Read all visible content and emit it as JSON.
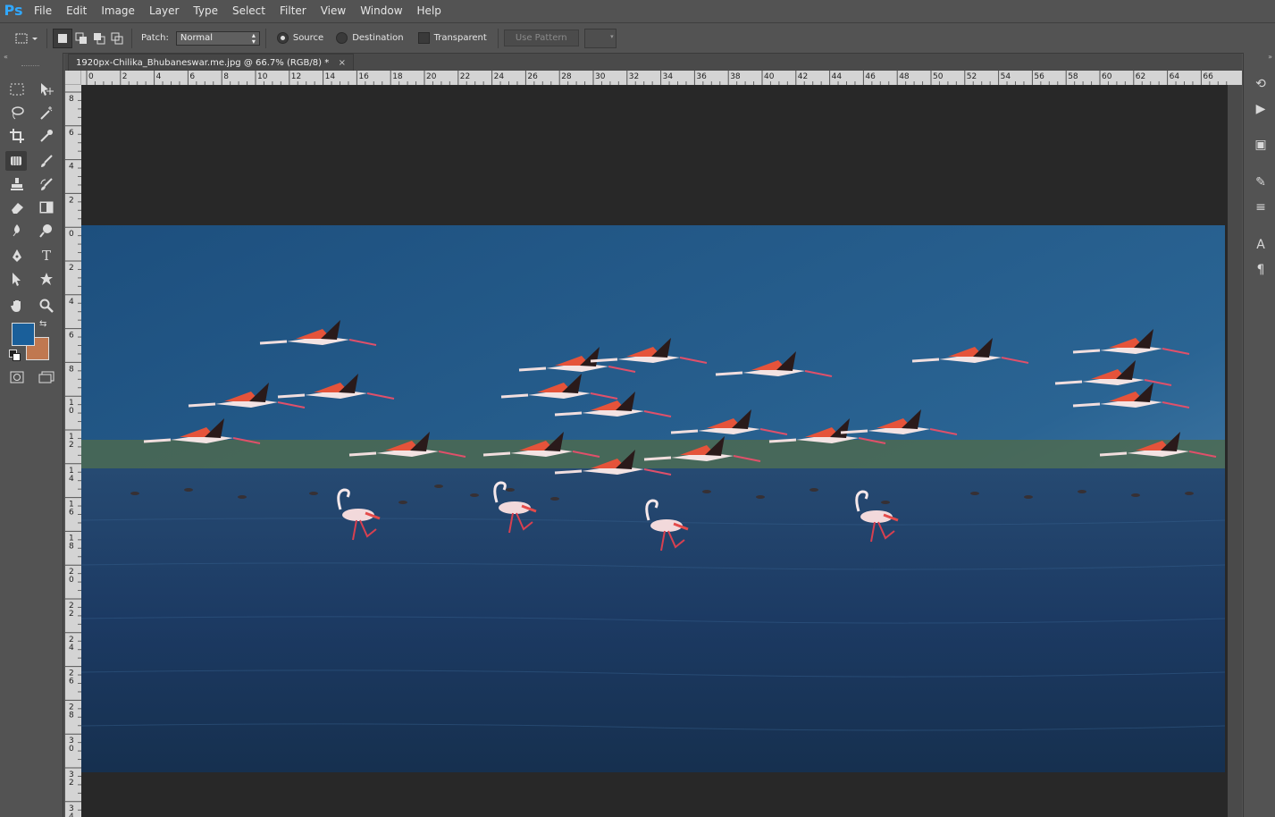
{
  "app": {
    "logo": "Ps"
  },
  "menu": [
    "File",
    "Edit",
    "Image",
    "Layer",
    "Type",
    "Select",
    "Filter",
    "View",
    "Window",
    "Help"
  ],
  "options": {
    "patch_label": "Patch:",
    "patch_value": "Normal",
    "source_label": "Source",
    "destination_label": "Destination",
    "transparent_label": "Transparent",
    "use_pattern_label": "Use Pattern",
    "source_selected": true
  },
  "document": {
    "tab_title": "1920px-Chilika_Bhubaneswar.me.jpg @ 66.7% (RGB/8) *",
    "close_glyph": "×"
  },
  "rulers": {
    "top_labels": [
      "0",
      "2",
      "4",
      "6",
      "8",
      "10",
      "12",
      "14",
      "16",
      "18",
      "20",
      "22",
      "24",
      "26",
      "28",
      "30",
      "32",
      "34",
      "36",
      "38",
      "40",
      "42",
      "44",
      "46",
      "48",
      "50",
      "52",
      "54",
      "56",
      "58",
      "60",
      "62",
      "64",
      "66"
    ],
    "left_labels": [
      "8",
      "6",
      "4",
      "2",
      "0",
      "2",
      "4",
      "6",
      "8",
      "10",
      "12",
      "14",
      "16",
      "18",
      "20",
      "22",
      "24",
      "26",
      "28",
      "30",
      "32",
      "34"
    ]
  },
  "colors": {
    "foreground": "#1a5f9a",
    "background": "#c07850",
    "ps_blue": "#31a8ff"
  },
  "tools_left": [
    "marquee-icon",
    "move-icon",
    "lasso-icon",
    "magic-wand-icon",
    "crop-icon",
    "eyedropper-icon",
    "patch-icon",
    "brush-icon",
    "stamp-icon",
    "history-brush-icon",
    "eraser-icon",
    "gradient-icon",
    "blur-icon",
    "dodge-icon",
    "pen-icon",
    "type-icon",
    "path-select-icon",
    "shape-icon",
    "hand-icon",
    "zoom-icon"
  ],
  "right_dock": [
    "history-icon",
    "play-icon",
    "layers-comp-icon",
    "brush-presets-icon",
    "adjustments-icon",
    "character-icon",
    "paragraph-icon"
  ]
}
